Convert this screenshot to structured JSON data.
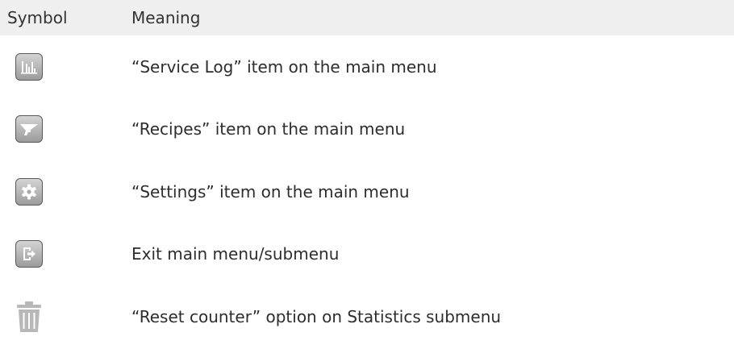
{
  "header": {
    "symbol": "Symbol",
    "meaning": "Meaning"
  },
  "rows": [
    {
      "icon": "bar-chart-icon",
      "meaning": "“Service Log” item on the main menu"
    },
    {
      "icon": "hopper-icon",
      "meaning": "“Recipes” item on the main menu"
    },
    {
      "icon": "gear-icon",
      "meaning": "“Settings” item on the main menu"
    },
    {
      "icon": "exit-icon",
      "meaning": "Exit main menu/submenu"
    },
    {
      "icon": "trash-icon",
      "meaning": "“Reset counter” option on Statistics submenu"
    }
  ],
  "colors": {
    "header_bg": "#efefef",
    "icon_fill": "#ffffff",
    "trash": "#b8b8b8"
  }
}
